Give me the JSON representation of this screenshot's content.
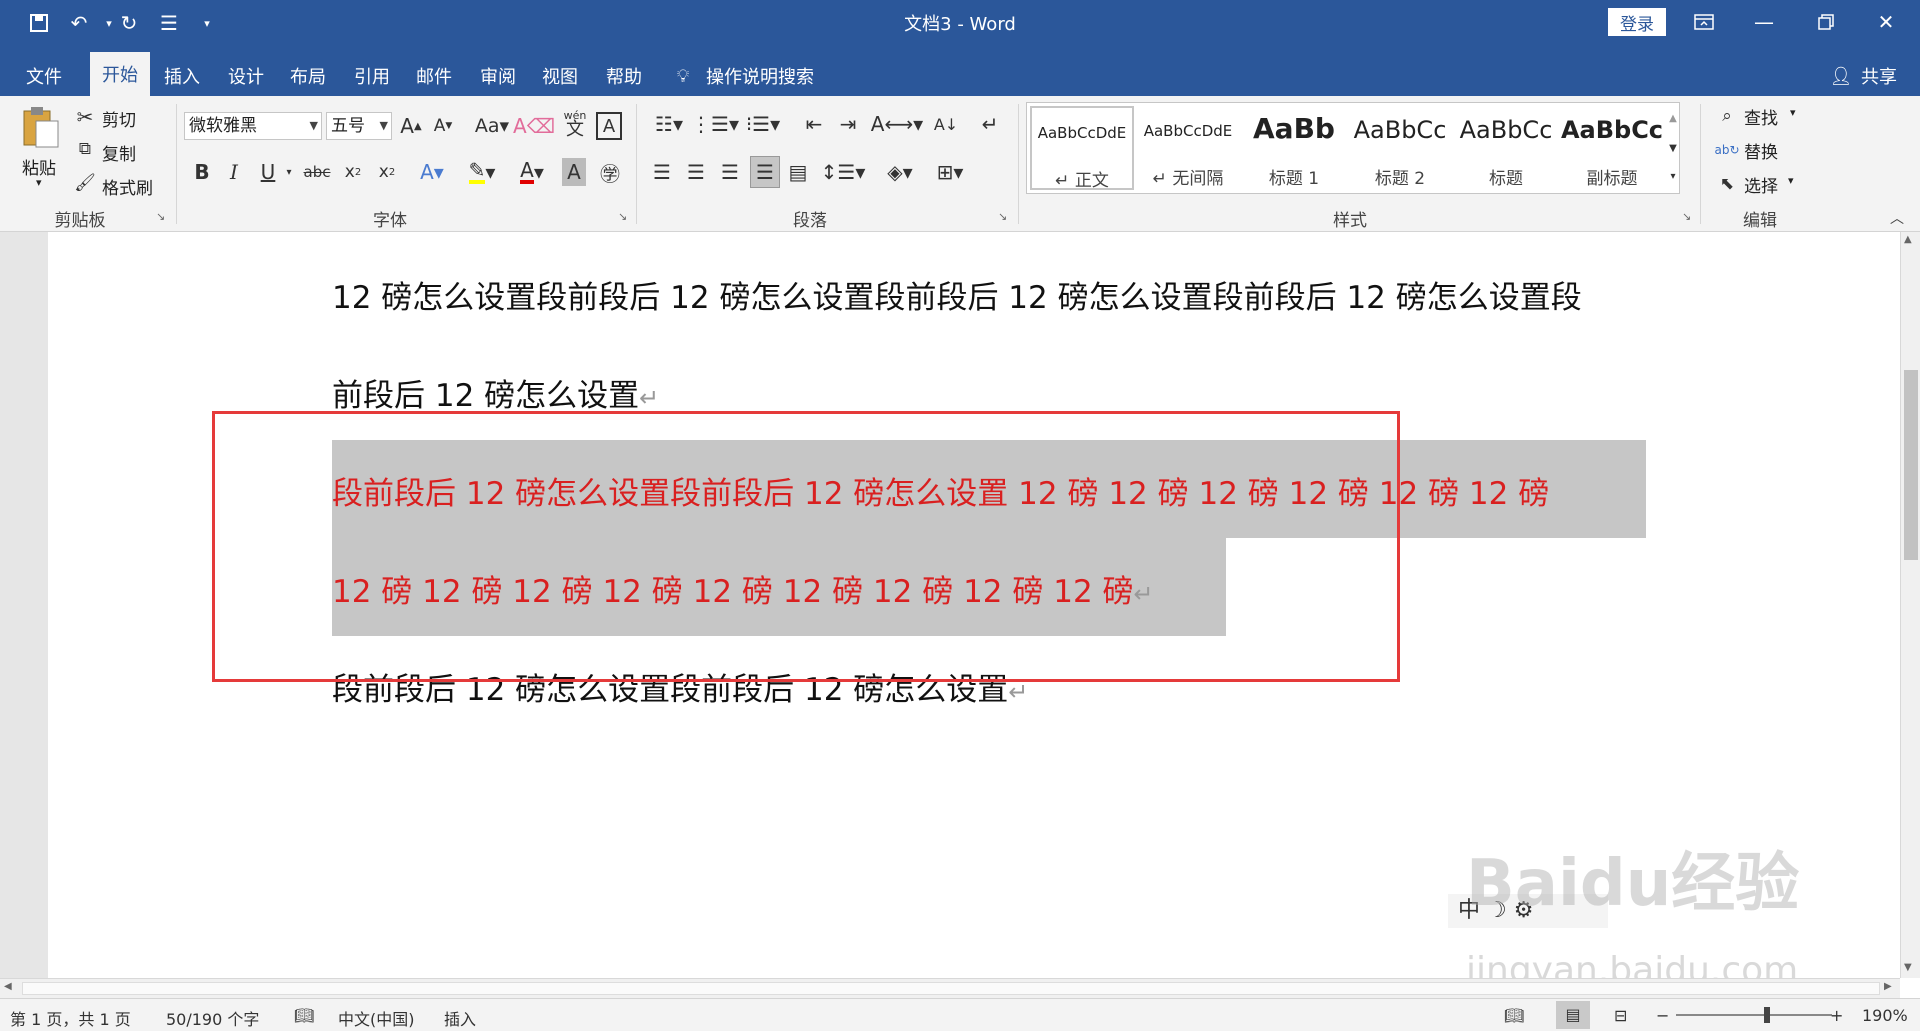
{
  "window": {
    "title": "文档3 - Word",
    "login_label": "登录",
    "share_label": "共享"
  },
  "tabs": [
    "文件",
    "开始",
    "插入",
    "设计",
    "布局",
    "引用",
    "邮件",
    "审阅",
    "视图",
    "帮助"
  ],
  "tell_me": "操作说明搜索",
  "clipboard": {
    "paste": "粘贴",
    "cut": "剪切",
    "copy": "复制",
    "format_painter": "格式刷",
    "group": "剪贴板"
  },
  "font": {
    "name": "微软雅黑",
    "size": "五号",
    "group": "字体",
    "wen": "wén",
    "wen_char": "文"
  },
  "paragraph": {
    "group": "段落"
  },
  "styles": {
    "group": "样式",
    "items": [
      {
        "preview": "AaBbCcDdE",
        "name": "↵ 正文"
      },
      {
        "preview": "AaBbCcDdE",
        "name": "↵ 无间隔"
      },
      {
        "preview": "AaBb",
        "name": "标题 1"
      },
      {
        "preview": "AaBbCc",
        "name": "标题 2"
      },
      {
        "preview": "AaBbCc",
        "name": "标题"
      },
      {
        "preview": "AaBbCc",
        "name": "副标题"
      }
    ]
  },
  "editing": {
    "find": "查找",
    "replace": "替换",
    "select": "选择",
    "group": "编辑"
  },
  "document": {
    "line1": "12 磅怎么设置段前段后 12 磅怎么设置段前段后 12 磅怎么设置段前段后 12 磅怎么设置段",
    "line2": "前段后 12 磅怎么设置",
    "line3": "段前段后 12 磅怎么设置段前段后 12 磅怎么设置 12  磅 12  磅 12  磅 12  磅 12  磅 12  磅",
    "line4": "12  磅 12  磅 12  磅 12  磅 12  磅 12  磅 12  磅 12  磅 12  磅",
    "line5": "段前段后 12 磅怎么设置段前段后 12 磅怎么设置",
    "para_mark": "↵",
    "ime": "中 ☽ ⚙"
  },
  "watermark": {
    "brand": "Baidu经验",
    "url": "jingyan.baidu.com"
  },
  "status": {
    "page": "第 1 页，共 1 页",
    "words": "50/190 个字",
    "language": "中文(中国)",
    "mode": "插入",
    "zoom": "190%"
  }
}
